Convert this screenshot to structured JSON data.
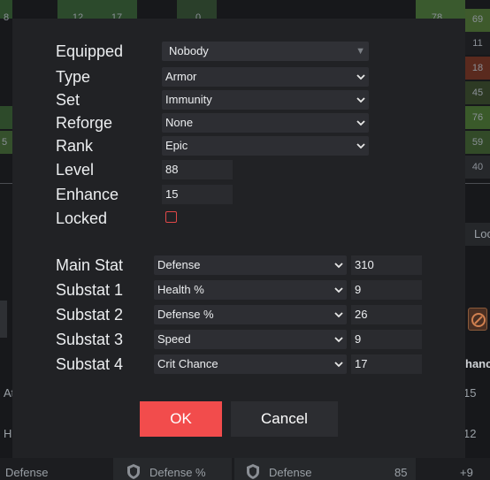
{
  "background": {
    "top_numbers": [
      "8",
      "12",
      "17",
      "0",
      "78",
      "69"
    ],
    "side_numbers": [
      "8",
      "5"
    ],
    "right_col": [
      "11",
      "18",
      "45",
      "76",
      "59",
      "40"
    ],
    "right_header": "Loc",
    "right_values": [
      "15",
      "12",
      "+9"
    ],
    "right_label": "hanc",
    "left_labels": [
      "At",
      "H"
    ],
    "bottom_row": {
      "col1": "Defense",
      "col2": "Defense %",
      "col3": "Defense",
      "value": "85"
    }
  },
  "form": {
    "equipped": {
      "label": "Equipped",
      "value": "Nobody"
    },
    "type": {
      "label": "Type",
      "value": "Armor"
    },
    "set": {
      "label": "Set",
      "value": "Immunity"
    },
    "reforge": {
      "label": "Reforge",
      "value": "None"
    },
    "rank": {
      "label": "Rank",
      "value": "Epic"
    },
    "level": {
      "label": "Level",
      "value": "88"
    },
    "enhance": {
      "label": "Enhance",
      "value": "15"
    },
    "locked": {
      "label": "Locked",
      "checked": false
    }
  },
  "stats": [
    {
      "label": "Main Stat",
      "stat": "Defense",
      "value": "310"
    },
    {
      "label": "Substat 1",
      "stat": "Health %",
      "value": "9"
    },
    {
      "label": "Substat 2",
      "stat": "Defense %",
      "value": "26"
    },
    {
      "label": "Substat 3",
      "stat": "Speed",
      "value": "9"
    },
    {
      "label": "Substat 4",
      "stat": "Crit Chance",
      "value": "17"
    }
  ],
  "buttons": {
    "ok": "OK",
    "cancel": "Cancel"
  },
  "colors": {
    "accent": "#f24c4c",
    "modal_bg": "#212225"
  },
  "icons": {
    "dropdown": "chevron-down-icon",
    "shield": "shield-icon",
    "emblem": "emblem-icon"
  }
}
